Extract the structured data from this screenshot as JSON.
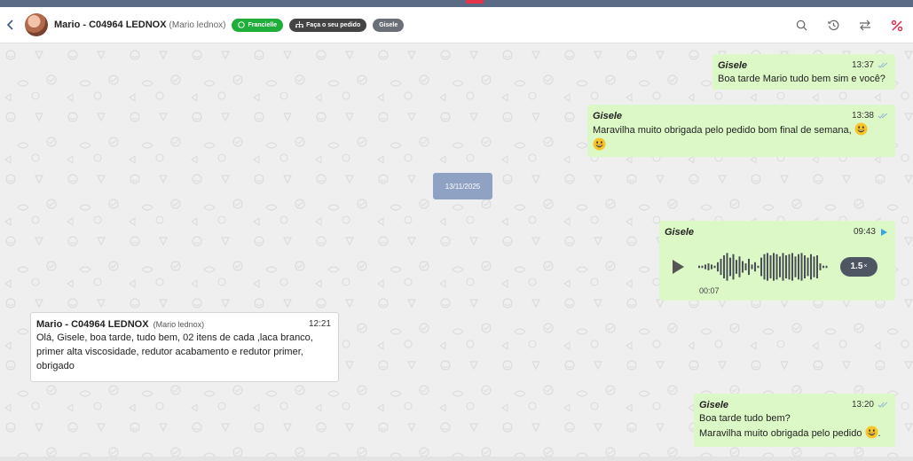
{
  "header": {
    "contact_name": "Mario - C04964 LEDNOX",
    "contact_subtitle": "(Mario lednox)",
    "tags": [
      {
        "label": "Francielle",
        "color": "#1fae3a"
      },
      {
        "label": "Faça o seu pedido",
        "color": "#444444"
      },
      {
        "label": "Gisele",
        "color": "#6b6f76"
      }
    ],
    "icons": [
      "search-icon",
      "history-icon",
      "transfer-icon",
      "percent-icon"
    ]
  },
  "date_separator": "13/11/2025",
  "messages": [
    {
      "author": "Gisele",
      "time": "13:37",
      "text": "Boa tarde Mario tudo bem sim e você?",
      "direction": "outgoing",
      "status": "read"
    },
    {
      "author": "Gisele",
      "time": "13:38",
      "text": "Maravilha muito obrigada pelo pedido bom final de semana,",
      "direction": "outgoing",
      "status": "read",
      "emojis": [
        "grinning-face",
        "grinning-face"
      ]
    },
    {
      "author": "Gisele",
      "time": "09:43",
      "type": "audio",
      "duration": "00:07",
      "speed": "1.5",
      "speed_suffix": "×",
      "direction": "outgoing"
    },
    {
      "author": "Mario - C04964 LEDNOX",
      "author_sub": "(Mario lednox)",
      "time": "12:21",
      "lines": [
        "Olá, Gisele, boa tarde, tudo bem, 02 itens de cada ,laca branco,",
        "primer alta viscosidade, redutor acabamento e redutor primer,",
        "obrigado"
      ],
      "direction": "incoming"
    },
    {
      "author": "Gisele",
      "time": "13:20",
      "lines": [
        "Boa tarde tudo bem?",
        "Maravilha muito obrigada pelo pedido"
      ],
      "trailing": ".",
      "direction": "outgoing",
      "status": "read",
      "emojis": [
        "grinning-face"
      ]
    }
  ],
  "colors": {
    "outgoing_bubble": "#dcf8c6",
    "incoming_bubble": "#ffffff",
    "date_chip": "#8fa2c4",
    "accent_red": "#e8344a"
  }
}
